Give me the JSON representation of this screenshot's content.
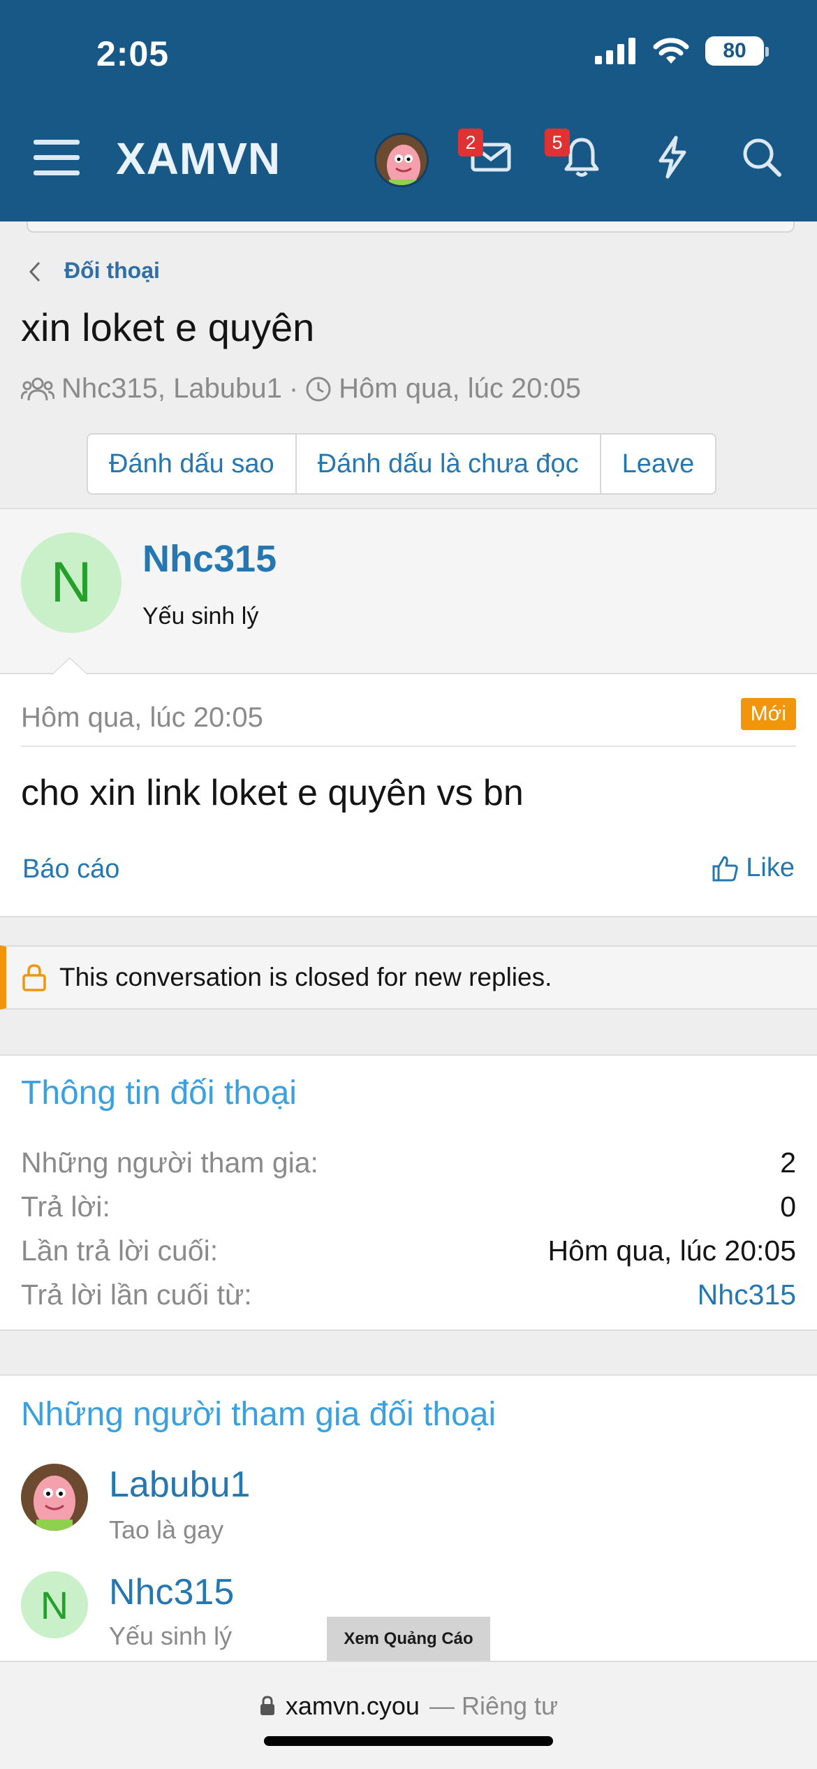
{
  "status_bar": {
    "time": "2:05",
    "battery": "80"
  },
  "navbar": {
    "brand": "XAMVN",
    "messages_badge": "2",
    "alerts_badge": "5"
  },
  "breadcrumb": {
    "label": "Đối thoại"
  },
  "conversation": {
    "title": "xin loket e quyên",
    "participants": "Nhc315, Labubu1",
    "separator": "·",
    "time": "Hôm qua, lúc 20:05",
    "buttons": {
      "star": "Đánh dấu sao",
      "mark_unread": "Đánh dấu là chưa đọc",
      "leave": "Leave"
    }
  },
  "author": {
    "initial": "N",
    "name": "Nhc315",
    "title": "Yếu sinh lý"
  },
  "message": {
    "date": "Hôm qua, lúc 20:05",
    "new_label": "Mới",
    "body": "cho xin link loket e quyên vs bn",
    "report": "Báo cáo",
    "like": "Like"
  },
  "notice": {
    "text": "This conversation is closed for new replies."
  },
  "info": {
    "title": "Thông tin đối thoại",
    "rows": [
      {
        "key": "Những người tham gia:",
        "value": "2"
      },
      {
        "key": "Trả lời:",
        "value": "0"
      },
      {
        "key": "Lần trả lời cuối:",
        "value": "Hôm qua, lúc 20:05"
      },
      {
        "key": "Trả lời lần cuối từ:",
        "value": "Nhc315"
      }
    ]
  },
  "participants": {
    "title": "Những người tham gia đối thoại",
    "items": [
      {
        "name": "Labubu1",
        "title": "Tao là gay"
      },
      {
        "initial": "N",
        "name": "Nhc315",
        "title": "Yếu sinh lý"
      }
    ]
  },
  "ad": {
    "label": "Xem Quảng Cáo"
  },
  "browser": {
    "domain": "xamvn.cyou",
    "suffix": "— Riêng tư"
  },
  "colors": {
    "header": "#185887",
    "link": "#2577b1",
    "accent": "#f0950c",
    "section_title": "#3aa0e0"
  }
}
